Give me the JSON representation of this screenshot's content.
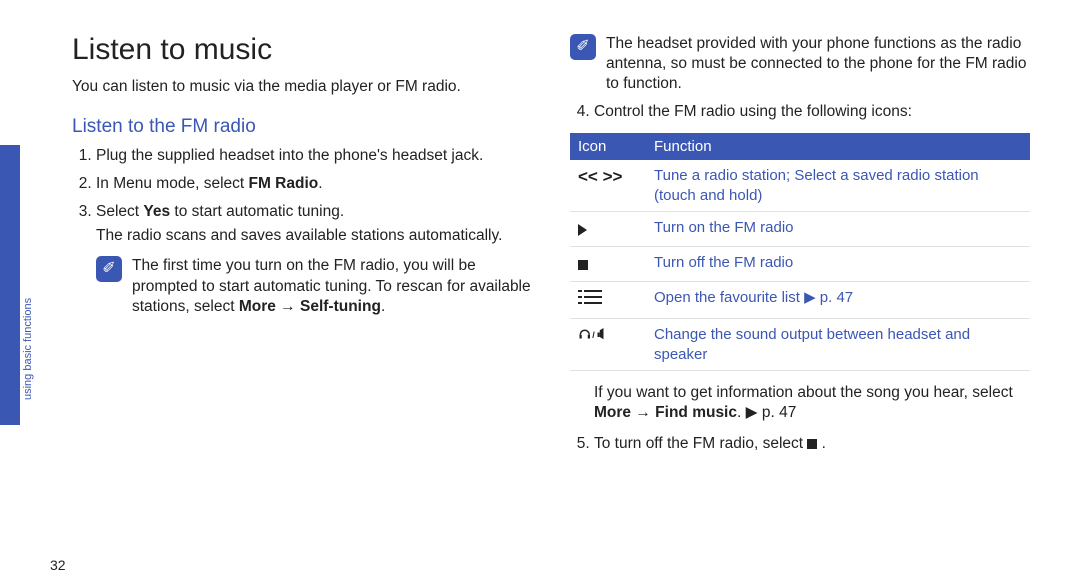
{
  "side_label": "using basic functions",
  "page_number": "32",
  "left": {
    "title": "Listen to music",
    "intro": "You can listen to music via the media player or FM radio.",
    "subheading": "Listen to the FM radio",
    "step1": "Plug the supplied headset into the phone's headset jack.",
    "step2_pre": "In Menu mode, select ",
    "step2_b": "FM Radio",
    "step2_post": ".",
    "step3_pre": "Select ",
    "step3_b": "Yes",
    "step3_post": " to start automatic tuning.",
    "step3_sub": "The radio scans and saves available stations automatically.",
    "note_pre": "The first time you turn on the FM radio, you will be prompted to start automatic tuning. To rescan for available stations, select ",
    "note_b1": "More",
    "note_arrow": " → ",
    "note_b2": "Self-tuning",
    "note_post": "."
  },
  "right": {
    "note": "The headset provided with your phone functions as the radio antenna, so must be connected to the phone for the FM radio to function.",
    "step4": "Control the FM radio using the following icons:",
    "th_icon": "Icon",
    "th_func": "Function",
    "row1_func": "Tune a radio station; Select a saved radio station (touch and hold)",
    "row2_func": "Turn on the FM radio",
    "row3_func": "Turn off the FM radio",
    "row4_func": "Open the favourite list ▶ p. 47",
    "row5_func": "Change the sound output between headset and speaker",
    "find_pre": "If you want to get information about the song you hear, select ",
    "find_b1": "More",
    "find_arrow": " → ",
    "find_b2": "Find music",
    "find_post": ". ▶ p. 47",
    "step5_pre": "To turn off the FM radio, select ",
    "step5_post": " ."
  }
}
